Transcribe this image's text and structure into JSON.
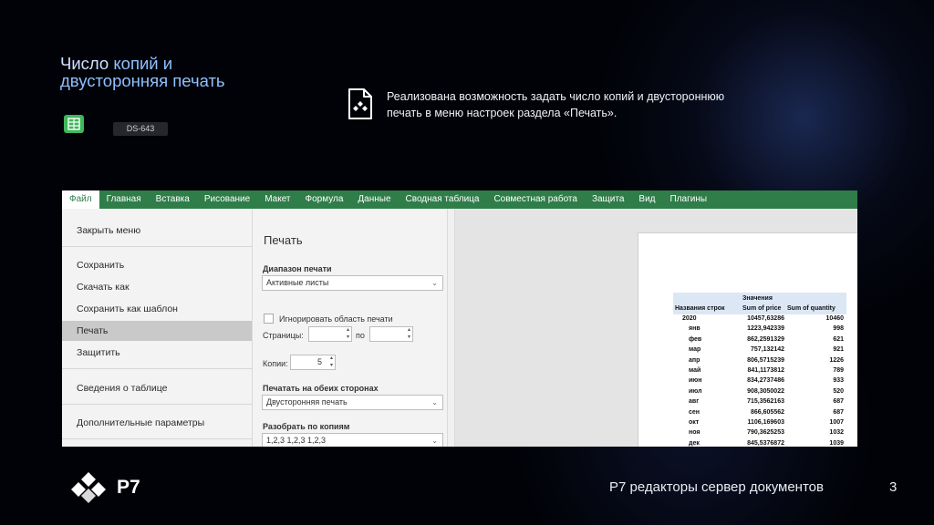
{
  "slide": {
    "title_line1_a": "Число ",
    "title_line1_b": "копий и",
    "title_line2": "двусторонняя печать",
    "tag": "DS-643",
    "description_line1": "Реализована возможность задать число копий и двустороннюю",
    "description_line2": "печать в меню настроек раздела «Печать».",
    "footer_text": "Р7 редакторы сервер документов",
    "page_number": "3",
    "logo_text": "Р7",
    "icons": {
      "sheet": "spreadsheet-icon",
      "doc": "document-icon",
      "logo": "r7-logo"
    }
  },
  "app": {
    "accent": "#2f7d49",
    "menubar": [
      "Файл",
      "Главная",
      "Вставка",
      "Рисование",
      "Макет",
      "Формула",
      "Данные",
      "Сводная таблица",
      "Совместная работа",
      "Защита",
      "Вид",
      "Плагины"
    ],
    "file_menu": {
      "close": "Закрыть меню",
      "save": "Сохранить",
      "download": "Скачать как",
      "save_template": "Сохранить как шаблон",
      "print": "Печать",
      "protect": "Защитить",
      "info": "Сведения о таблице",
      "advanced": "Дополнительные параметры"
    },
    "print": {
      "title": "Печать",
      "range_label": "Диапазон печати",
      "range_value": "Активные листы",
      "ignore_area": "Игнорировать область печати",
      "pages_label": "Страницы:",
      "pages_to": "по",
      "pages_from_value": "",
      "pages_to_value": "",
      "copies_label": "Копии:",
      "copies_value": "5",
      "duplex_label": "Печатать на обеих сторонах",
      "duplex_value": "Двусторонняя печать",
      "collate_label": "Разобрать по копиям",
      "collate_value": "1,2,3  1,2,3  1,2,3"
    },
    "preview": {
      "values_header": "Значения",
      "col_rows": "Названия строк",
      "col_price": "Sum of price",
      "col_qty": "Sum of quantity",
      "rows": [
        {
          "name": "2020",
          "price": "10457,63286",
          "qty": "10460",
          "bold": true
        },
        {
          "name": "янв",
          "price": "1223,942339",
          "qty": "998"
        },
        {
          "name": "фев",
          "price": "862,2591329",
          "qty": "621"
        },
        {
          "name": "мар",
          "price": "757,132142",
          "qty": "921"
        },
        {
          "name": "апр",
          "price": "806,5715239",
          "qty": "1226"
        },
        {
          "name": "май",
          "price": "841,1173812",
          "qty": "789"
        },
        {
          "name": "июн",
          "price": "834,2737486",
          "qty": "933"
        },
        {
          "name": "июл",
          "price": "908,3050022",
          "qty": "520"
        },
        {
          "name": "авг",
          "price": "715,3562163",
          "qty": "687"
        },
        {
          "name": "сен",
          "price": "866,605562",
          "qty": "687"
        },
        {
          "name": "окт",
          "price": "1106,169603",
          "qty": "1007"
        },
        {
          "name": "ноя",
          "price": "790,3625253",
          "qty": "1032"
        },
        {
          "name": "дек",
          "price": "845,5376872",
          "qty": "1039"
        }
      ]
    }
  }
}
